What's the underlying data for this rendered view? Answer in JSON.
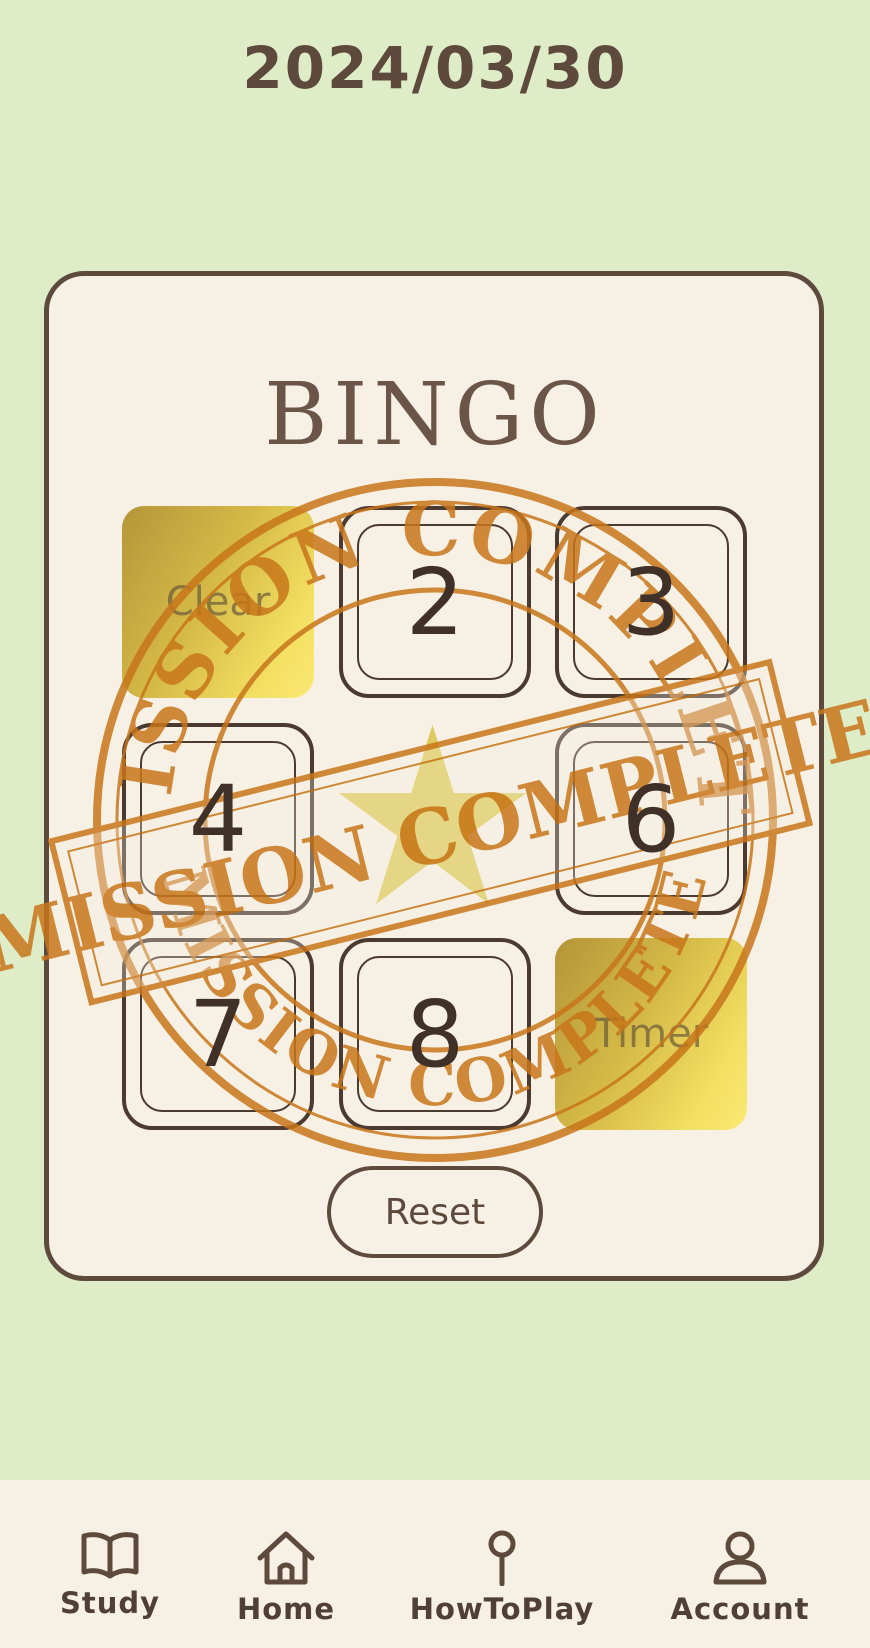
{
  "date": "2024/03/30",
  "card": {
    "title": "BINGO",
    "tiles": [
      {
        "label": "Clear",
        "state": "cleared"
      },
      {
        "label": "2",
        "state": "open"
      },
      {
        "label": "3",
        "state": "open"
      },
      {
        "label": "4",
        "state": "open"
      },
      {
        "label": "",
        "state": "free-star"
      },
      {
        "label": "6",
        "state": "open"
      },
      {
        "label": "7",
        "state": "open"
      },
      {
        "label": "8",
        "state": "open"
      },
      {
        "label": "Timer",
        "state": "cleared"
      }
    ],
    "reset_label": "Reset"
  },
  "stamp": {
    "text": "MISSION COMPLETE",
    "color": "#c8761a"
  },
  "nav": {
    "items": [
      {
        "label": "Study",
        "icon": "book-icon"
      },
      {
        "label": "Home",
        "icon": "home-icon"
      },
      {
        "label": "HowToPlay",
        "icon": "pin-icon"
      },
      {
        "label": "Account",
        "icon": "person-icon"
      }
    ]
  },
  "colors": {
    "background": "#deedc7",
    "card": "#f7f0e4",
    "outline": "#5d4a3d",
    "gold": "#f3df62",
    "star": "#d9c64e"
  }
}
